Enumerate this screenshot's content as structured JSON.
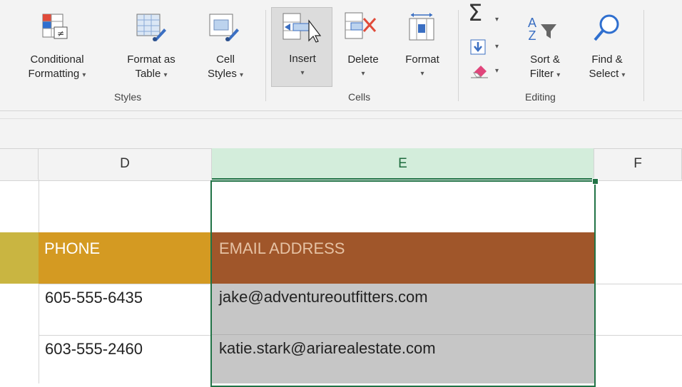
{
  "ribbon": {
    "styles": {
      "group_label": "Styles",
      "conditional_formatting": [
        "Conditional",
        "Formatting"
      ],
      "format_as_table": [
        "Format as",
        "Table"
      ],
      "cell_styles": [
        "Cell",
        "Styles"
      ]
    },
    "cells": {
      "group_label": "Cells",
      "insert": "Insert",
      "delete": "Delete",
      "format": "Format"
    },
    "editing": {
      "group_label": "Editing",
      "sort_filter": [
        "Sort &",
        "Filter"
      ],
      "find_select": [
        "Find &",
        "Select"
      ]
    },
    "dropdown_glyph": "▾"
  },
  "columns": [
    "D",
    "E",
    "F"
  ],
  "rows": [
    {
      "phone": "",
      "email": ""
    },
    {
      "phone": "PHONE",
      "email": "EMAIL ADDRESS"
    },
    {
      "phone": "605-555-6435",
      "email": "jake@adventureoutfitters.com"
    },
    {
      "phone": "603-555-2460",
      "email": "katie.stark@ariarealestate.com"
    }
  ],
  "colors": {
    "phone_header_bg": "#d49a22",
    "email_header_bg": "#a0562a",
    "selected_col_header_bg": "#d3eddb",
    "selection_border": "#217346",
    "email_cells_bg": "#c6c6c6",
    "left_header_accent": "#c9b541"
  }
}
